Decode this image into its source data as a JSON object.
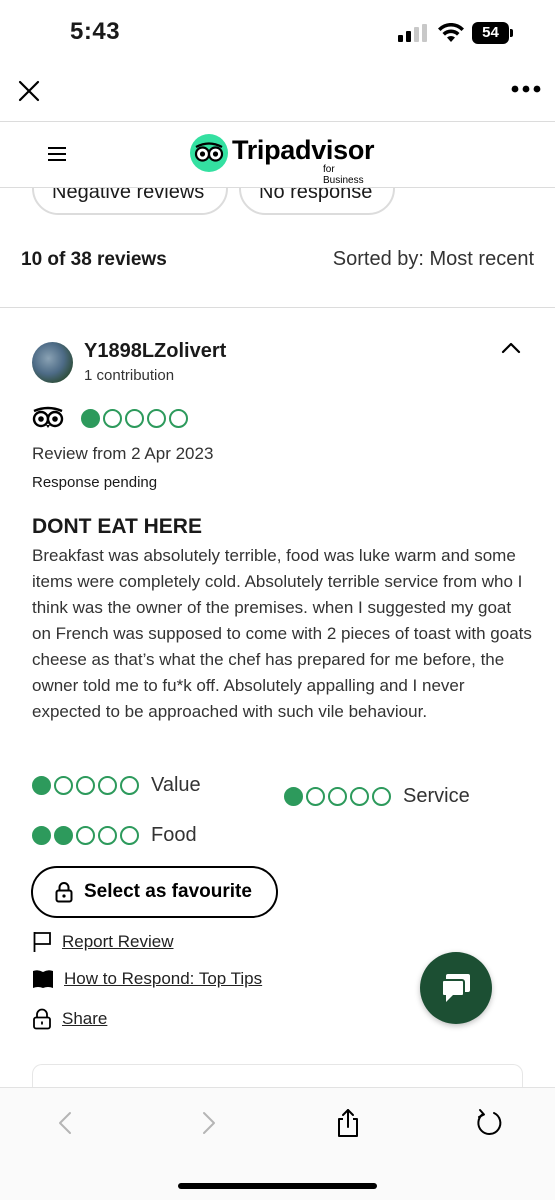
{
  "status_bar": {
    "time": "5:43",
    "battery": "54"
  },
  "app": {
    "logo_name": "Tripadvisor",
    "logo_sub": "for Business"
  },
  "filters": {
    "chips": [
      "Negative reviews",
      "No response"
    ]
  },
  "list": {
    "count": "10 of 38 reviews",
    "sort": "Sorted by: Most recent"
  },
  "review": {
    "reviewer": "Y1898LZolivert",
    "contributions": "1 contribution",
    "overall_rating": 1,
    "date": "Review from 2 Apr 2023",
    "response_status": "Response pending",
    "title": "DONT EAT HERE",
    "body": "Breakfast was absolutely terrible, food was luke warm and some items were completely cold. Absolutely terrible service from who I think was the owner of the premises. when I suggested my goat on French was supposed to come with 2 pieces of toast with goats cheese as that’s what the chef has prepared for me before, the owner told me to fu*k off. Absolutely appalling and I never expected to be approached with such vile behaviour.",
    "sub_ratings": {
      "value": {
        "label": "Value",
        "score": 1
      },
      "service": {
        "label": "Service",
        "score": 1
      },
      "food": {
        "label": "Food",
        "score": 2
      }
    },
    "favourite_label": "Select as favourite",
    "links": {
      "report": "Report Review",
      "tips": "How to Respond: Top Tips",
      "share": "Share"
    }
  },
  "colors": {
    "bubble": "#2d9a5c",
    "logo": "#34e0a1",
    "fab": "#1c4f33"
  },
  "icons": [
    "close-icon",
    "more-icon",
    "hamburger-icon",
    "owl-icon",
    "chevron-up-icon",
    "lock-icon",
    "flag-icon",
    "book-icon",
    "chat-icon",
    "back-icon",
    "forward-icon",
    "share-icon",
    "reload-icon"
  ]
}
